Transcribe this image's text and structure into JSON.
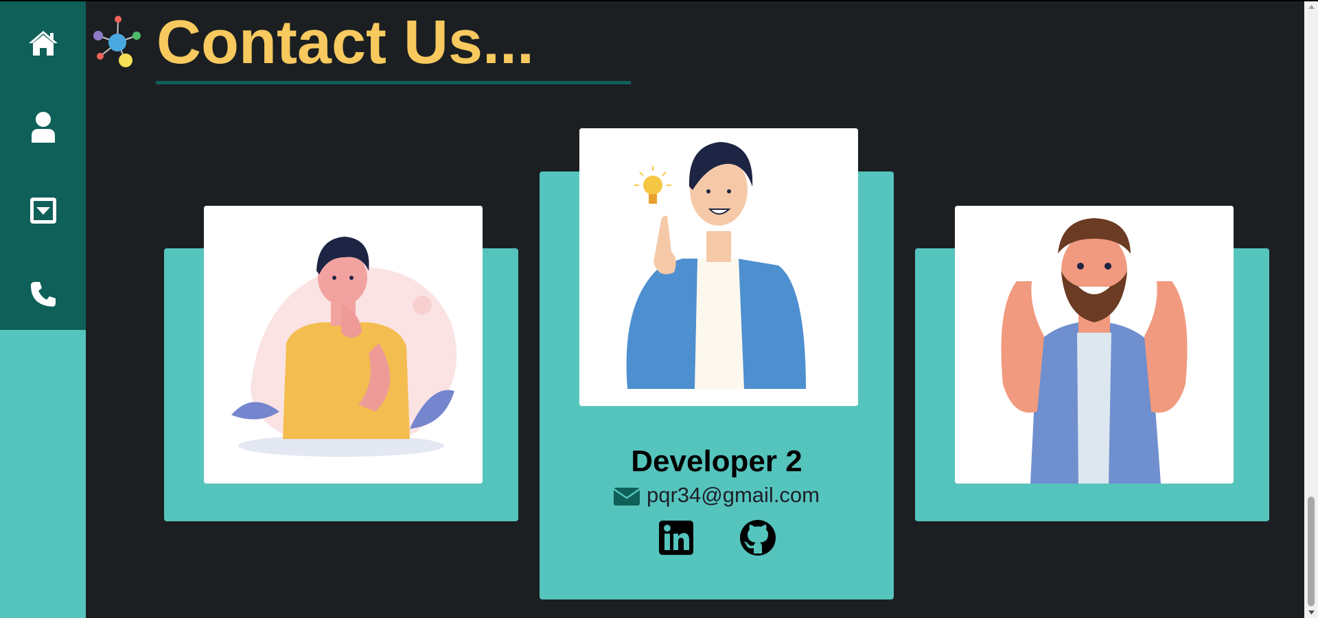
{
  "page": {
    "title": "Contact Us...",
    "background": "#1c1f22",
    "title_color": "#f7c95e",
    "accent": "#0e6058",
    "card_color": "#55c4bd"
  },
  "sidebar": {
    "items": [
      {
        "name": "home",
        "icon": "home-icon"
      },
      {
        "name": "about",
        "icon": "user-icon"
      },
      {
        "name": "projects",
        "icon": "caret-square-down-icon"
      },
      {
        "name": "contact",
        "icon": "phone-icon"
      }
    ]
  },
  "developers": [
    {
      "illustration": "thinking-man-illustration"
    },
    {
      "name": "Developer 2",
      "email": "pqr34@gmail.com",
      "illustration": "idea-man-illustration",
      "links": [
        "linkedin-icon",
        "github-icon"
      ]
    },
    {
      "illustration": "thumbs-up-man-illustration"
    }
  ]
}
